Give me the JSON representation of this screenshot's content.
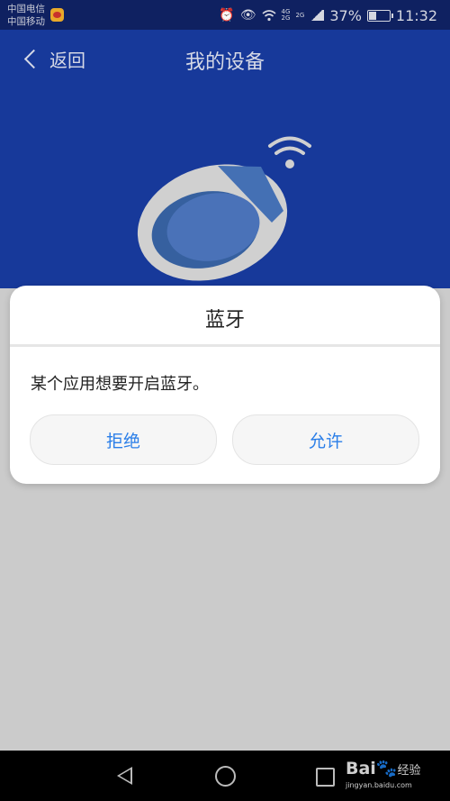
{
  "status_bar": {
    "carrier_1": "中国电信",
    "carrier_2": "中国移动",
    "notification_app": "weibo-icon",
    "icons": [
      "alarm-icon",
      "eye-icon",
      "wifi-icon",
      "4G-2G-signal-icon",
      "2G-signal-icon"
    ],
    "signal_label_1a": "4G",
    "signal_label_1b": "2G",
    "signal_label_2": "2G",
    "battery": "37%",
    "time": "11:32"
  },
  "header": {
    "back_label": "返回",
    "title": "我的设备"
  },
  "dialog": {
    "title": "蓝牙",
    "message": "某个应用想要开启蓝牙。",
    "deny_label": "拒绝",
    "allow_label": "允许",
    "accent_color": "#2a7ee8"
  },
  "nav_bar": {
    "watermark_brand": "Bai",
    "watermark_brand_2": "du",
    "watermark_cn": "经验",
    "watermark_url": "jingyan.baidu.com"
  },
  "colors": {
    "header_bg": "#17399a",
    "status_bg": "#0f2161",
    "overlay_bg": "#cbcbcb"
  }
}
